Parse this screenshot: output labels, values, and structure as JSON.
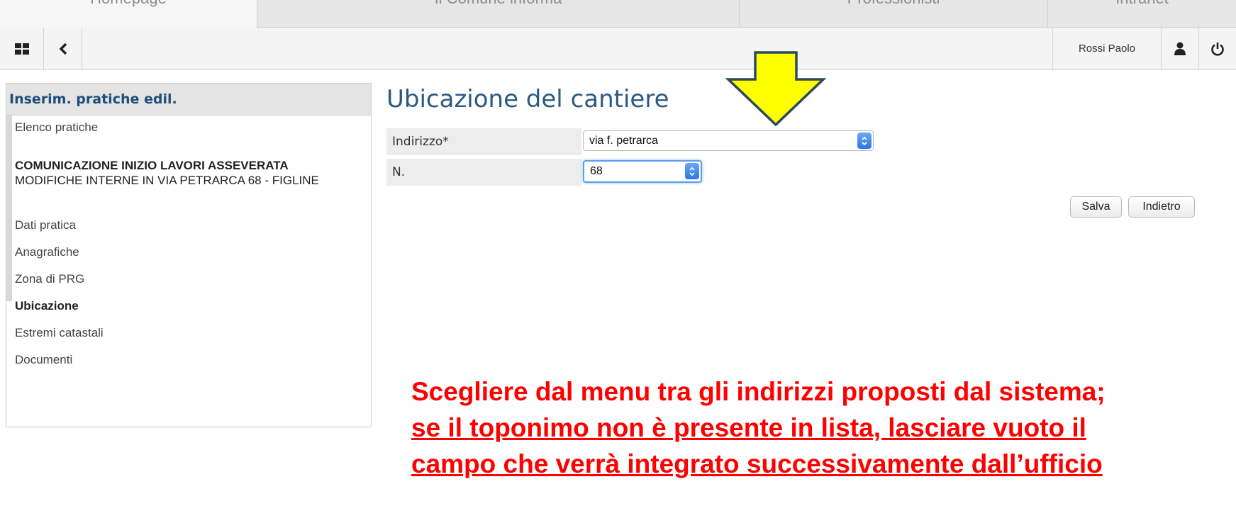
{
  "top_tabs": [
    "Homepage",
    "Il Comune informa",
    "Professionisti",
    "Intranet"
  ],
  "toolbar": {
    "apps_icon": "grid-icon",
    "back_icon": "chevron-left-icon",
    "user_name": "Rossi Paolo",
    "user_icon": "user-icon",
    "power_icon": "power-icon"
  },
  "sidebar": {
    "title": "Inserim. pratiche edil.",
    "list_link": "Elenco pratiche",
    "practice_title": "COMUNICAZIONE INIZIO LAVORI ASSEVERATA",
    "practice_description": "MODIFICHE INTERNE IN VIA PETRARCA 68 - FIGLINE",
    "items": [
      "Dati pratica",
      "Anagrafiche",
      "Zona di PRG",
      "Ubicazione",
      "Estremi catastali",
      "Documenti"
    ],
    "active_item": "Ubicazione"
  },
  "main": {
    "title": "Ubicazione del cantiere",
    "address_label": "Indirizzo*",
    "address_value": "via f. petrarca",
    "number_label": "N.",
    "number_value": "68",
    "save_label": "Salva",
    "back_label": "Indietro"
  },
  "annotation": {
    "line1": "Scegliere dal menu tra gli indirizzi proposti dal sistema;",
    "line2": "se il toponimo non è presente in lista, lasciare vuoto il",
    "line3": "campo che verrà integrato successivamente dall’ufficio",
    "text_color": "#ff0000",
    "arrow_color": "#ffff00"
  }
}
